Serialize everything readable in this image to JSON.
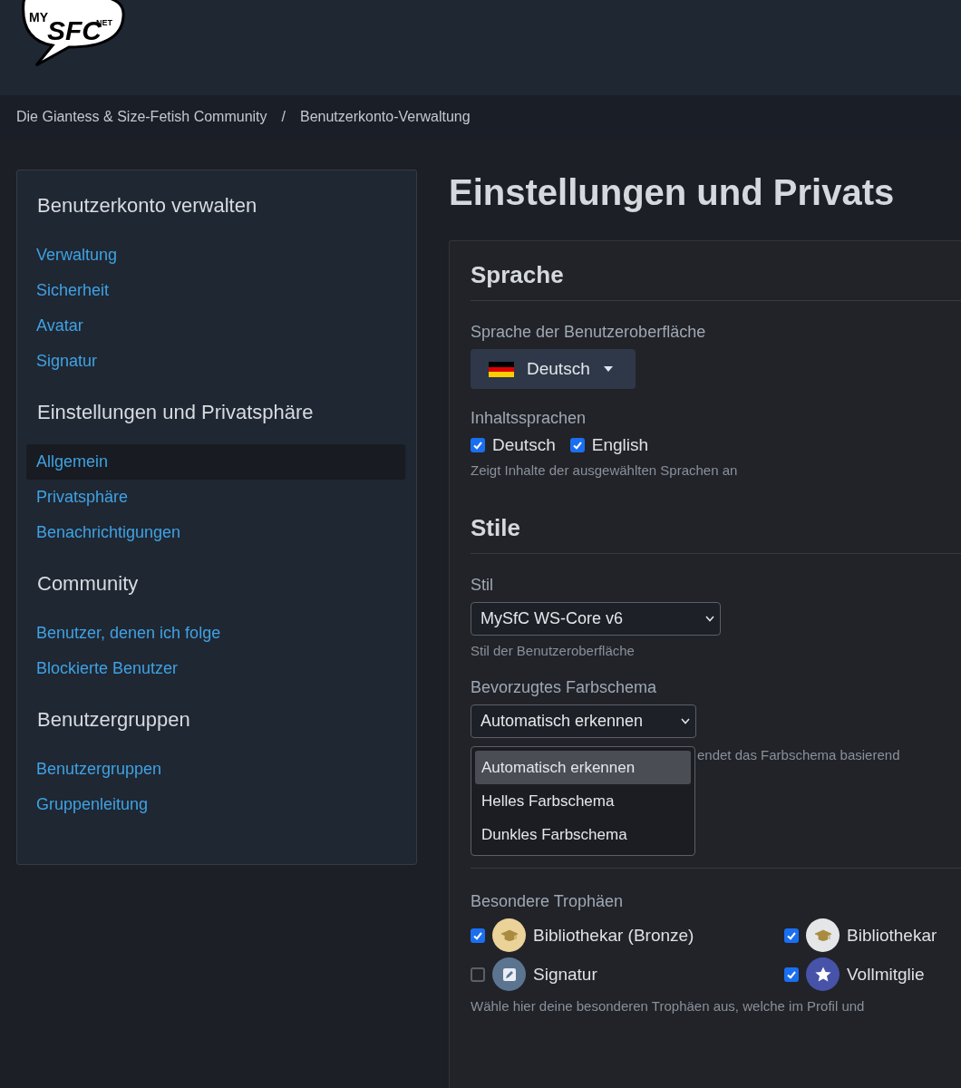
{
  "logo": {
    "texts": [
      "MY",
      "SFC",
      "NET"
    ]
  },
  "breadcrumbs": [
    "Die Giantess & Size-Fetish Community",
    "/",
    "Benutzerkonto-Verwaltung"
  ],
  "sidebar": {
    "sections": [
      {
        "title": "Benutzerkonto verwalten",
        "items": [
          {
            "label": "Verwaltung",
            "selected": false
          },
          {
            "label": "Sicherheit",
            "selected": false
          },
          {
            "label": "Avatar",
            "selected": false
          },
          {
            "label": "Signatur",
            "selected": false
          }
        ]
      },
      {
        "title": "Einstellungen und Privatsphäre",
        "items": [
          {
            "label": "Allgemein",
            "selected": true
          },
          {
            "label": "Privatsphäre",
            "selected": false
          },
          {
            "label": "Benachrichtigungen",
            "selected": false
          }
        ]
      },
      {
        "title": "Community",
        "items": [
          {
            "label": "Benutzer, denen ich folge",
            "selected": false
          },
          {
            "label": "Blockierte Benutzer",
            "selected": false
          }
        ]
      },
      {
        "title": "Benutzergruppen",
        "items": [
          {
            "label": "Benutzergruppen",
            "selected": false
          },
          {
            "label": "Gruppenleitung",
            "selected": false
          }
        ]
      }
    ]
  },
  "page_title": "Einstellungen und Privats",
  "sections": [
    {
      "title": "Sprache",
      "fields": [
        {
          "kind": "language",
          "label": "Sprache der Benutzeroberfläche",
          "value": "Deutsch"
        },
        {
          "kind": "checks",
          "label": "Inhaltssprachen",
          "options": [
            {
              "label": "Deutsch",
              "checked": true
            },
            {
              "label": "English",
              "checked": true
            }
          ],
          "hint": "Zeigt Inhalte der ausgewählten Sprachen an"
        }
      ]
    },
    {
      "title": "Stile",
      "fields": [
        {
          "kind": "select",
          "label": "Stil",
          "value": "MySfC WS-Core v6",
          "hint": "Stil der Benutzeroberfläche"
        },
        {
          "kind": "open_select",
          "label": "Bevorzugtes Farbschema",
          "value": "Automatisch erkennen",
          "options": [
            {
              "label": "Automatisch erkennen",
              "selected": true
            },
            {
              "label": "Helles Farbschema",
              "selected": false
            },
            {
              "label": "Dunkles Farbschema",
              "selected": false
            }
          ],
          "hint": "endet das Farbschema basierend"
        }
      ]
    },
    {
      "fields": [
        {
          "kind": "trophies",
          "label": "Besondere Trophäen",
          "trophies": [
            {
              "label": "Bibliothekar (Bronze)",
              "checked": true,
              "kind": "cap",
              "color": "#ebd298"
            },
            {
              "label": "Bibliothekar",
              "checked": true,
              "kind": "cap",
              "color": "#e4e6e8"
            },
            {
              "label": "Signatur",
              "checked": false,
              "kind": "pencil",
              "color": "#5b7591"
            },
            {
              "label": "Vollmitglie",
              "checked": true,
              "kind": "star",
              "color": "#4653a8"
            }
          ],
          "hint": "Wähle hier deine besonderen Trophäen aus, welche im Profil und"
        }
      ]
    }
  ]
}
